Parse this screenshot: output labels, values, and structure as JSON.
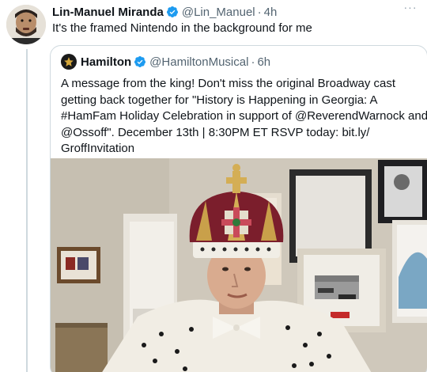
{
  "tweet": {
    "author_name": "Lin-Manuel Miranda",
    "author_handle": "@Lin_Manuel",
    "separator": "·",
    "time": "4h",
    "more_label": "···",
    "text": "It's the framed Nintendo in the background for me"
  },
  "quoted": {
    "author_name": "Hamilton",
    "author_handle": "@HamiltonMusical",
    "separator": "·",
    "time": "6h",
    "text_lines": [
      "A message from the king! Don't miss the original Broadway cast",
      "getting back together for \"History is Happening in Georgia: A",
      "#HamFam Holiday Celebration in support of @ReverendWarnock and",
      "@Ossoff\". December 13th | 8:30PM ET RSVP today: bit.ly/",
      "GroffInvitation"
    ],
    "media": {
      "description_icon": "video-still",
      "subject": "man wearing crown and ermine robe"
    }
  },
  "colors": {
    "verified": "#1d9bf0",
    "secondary_text": "#536471",
    "border": "#cfd9de"
  },
  "icons": {
    "verified": "verified-badge-icon",
    "more": "more-options-icon",
    "hamilton_avatar": "star-icon"
  }
}
